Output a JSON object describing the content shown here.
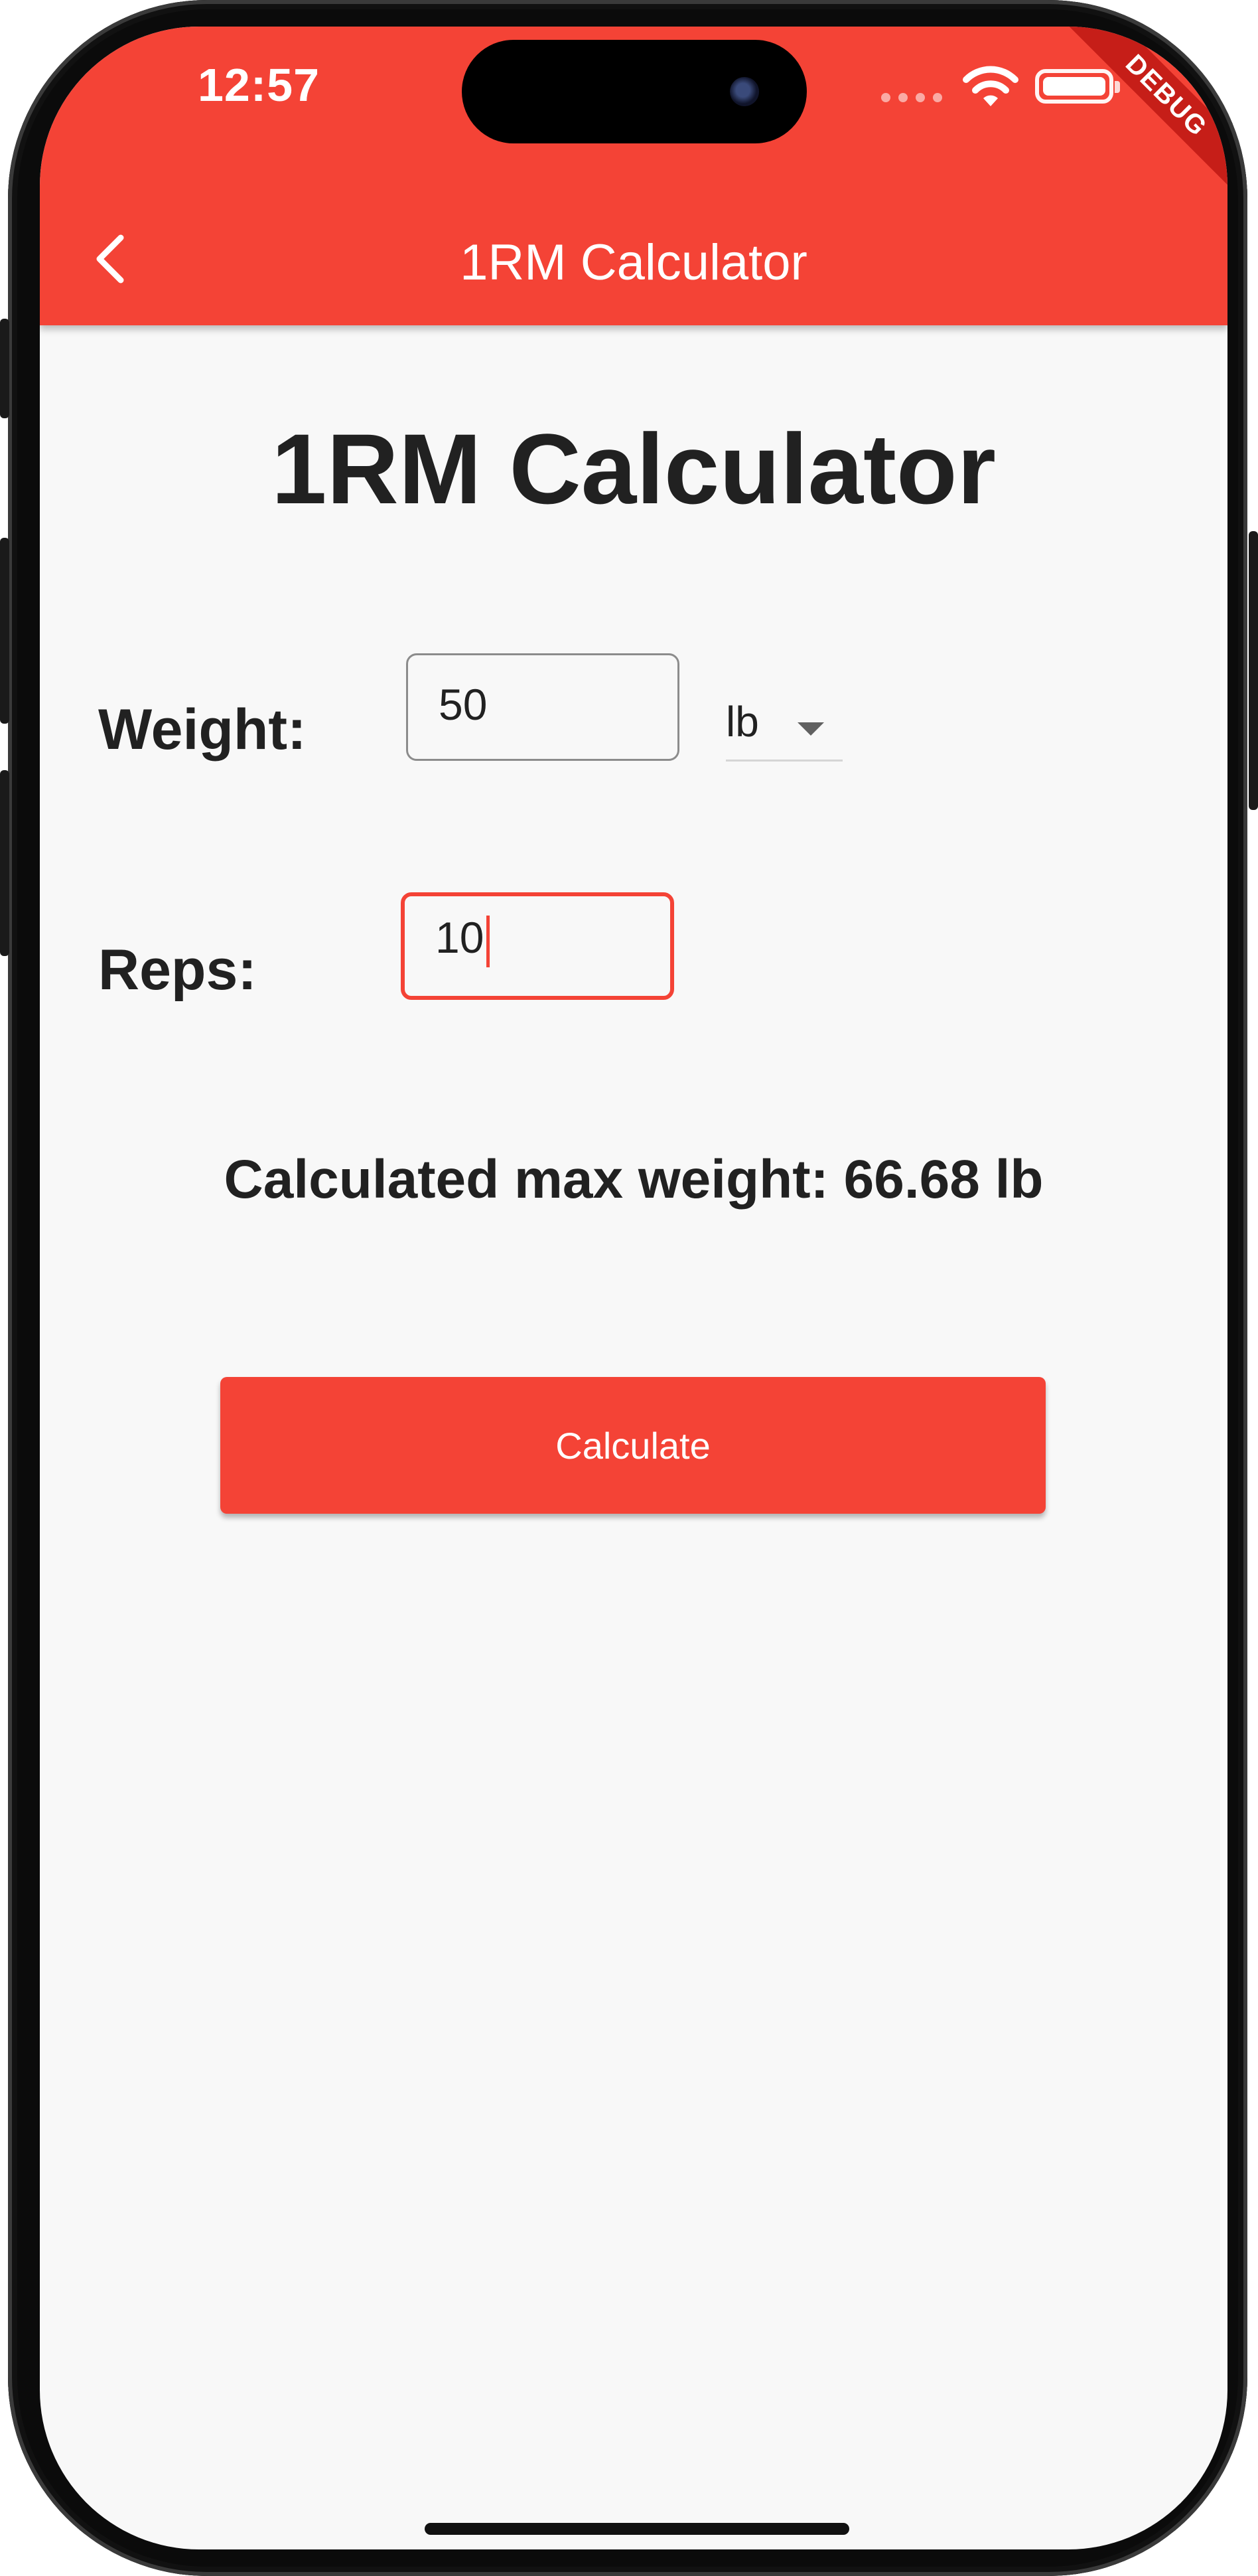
{
  "status_bar": {
    "time": "12:57",
    "debug_label": "DEBUG"
  },
  "app_bar": {
    "title": "1RM Calculator",
    "background_color": "#f44336"
  },
  "main": {
    "heading": "1RM Calculator",
    "weight": {
      "label": "Weight:",
      "value": "50",
      "unit": "lb"
    },
    "reps": {
      "label": "Reps:",
      "value": "10"
    },
    "result": "Calculated max weight: 66.68 lb",
    "calculate_label": "Calculate"
  },
  "colors": {
    "accent": "#f44336",
    "text": "#212121",
    "background": "#f8f8f8"
  }
}
